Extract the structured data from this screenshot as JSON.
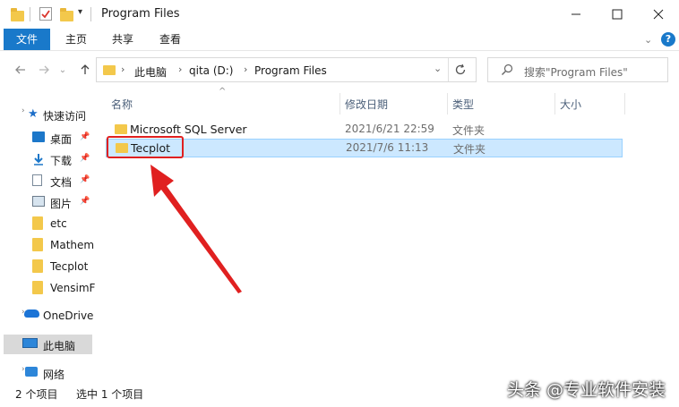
{
  "window": {
    "title": "Program Files"
  },
  "ribbon": {
    "tabs": [
      "文件",
      "主页",
      "共享",
      "查看"
    ]
  },
  "address": {
    "crumbs": [
      "此电脑",
      "qita (D:)",
      "Program Files"
    ]
  },
  "search": {
    "placeholder": "搜索\"Program Files\""
  },
  "nav": {
    "quick_access": "快速访问",
    "items": [
      "桌面",
      "下载",
      "文档",
      "图片",
      "etc",
      "Mathem",
      "Tecplot",
      "VensimF"
    ],
    "onedrive": "OneDrive",
    "this_pc": "此电脑",
    "network": "网络"
  },
  "columns": {
    "name": "名称",
    "date": "修改日期",
    "type": "类型",
    "size": "大小"
  },
  "rows": [
    {
      "name": "Microsoft SQL Server",
      "date": "2021/6/21 22:59",
      "type": "文件夹"
    },
    {
      "name": "Tecplot",
      "date": "2021/7/6 11:13",
      "type": "文件夹"
    }
  ],
  "status": {
    "count": "2 个项目",
    "selected": "选中 1 个项目"
  },
  "watermark": "头条 @专业软件安装",
  "colors": {
    "accent": "#1979ca",
    "selection": "#cce8ff",
    "annotation": "#e02020"
  }
}
